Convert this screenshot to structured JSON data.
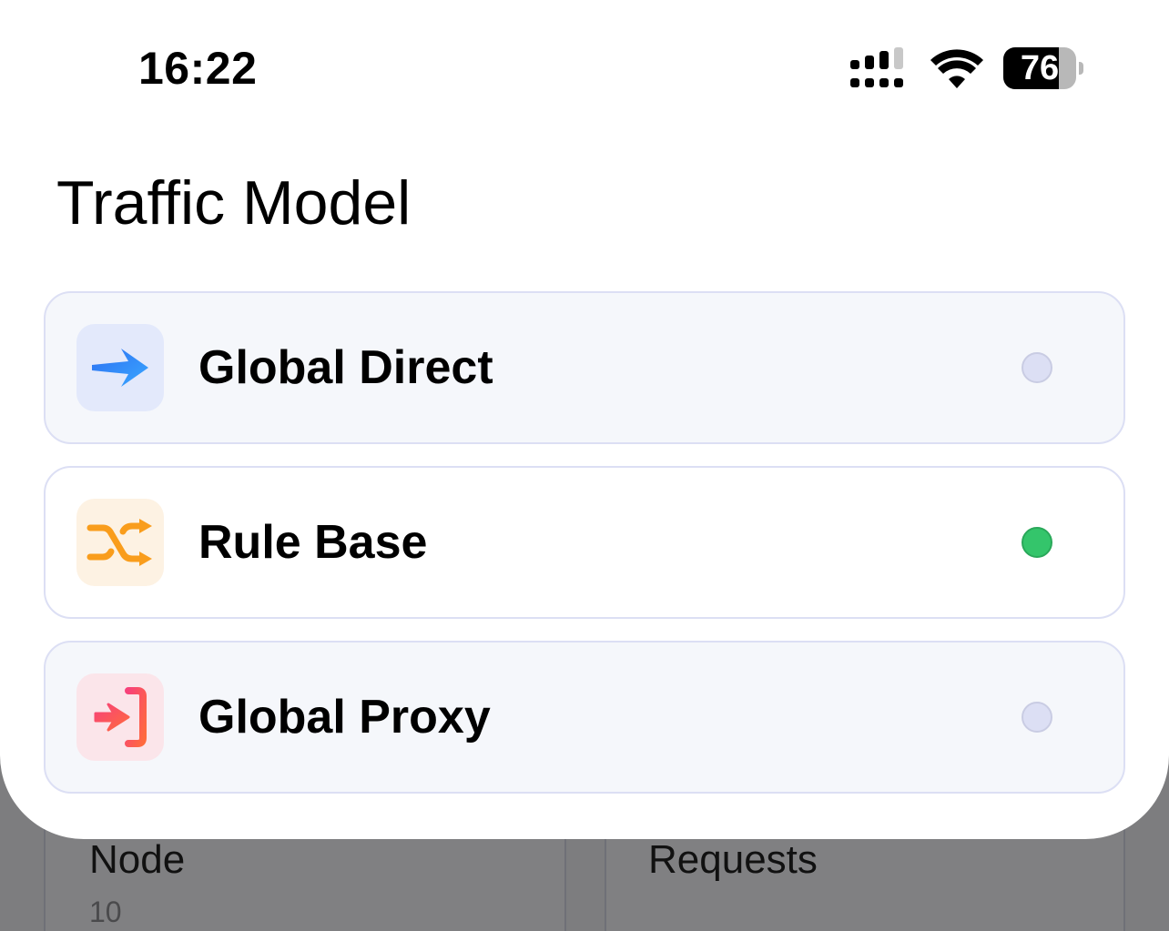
{
  "status_bar": {
    "time": "16:22",
    "battery_percent": 76,
    "battery_label": "76",
    "icons": [
      "cellular-signal-icon",
      "wifi-icon",
      "battery-icon"
    ]
  },
  "sheet": {
    "title": "Traffic Model",
    "options": [
      {
        "label": "Global Direct",
        "icon": "direct-arrow-icon",
        "icon_bg": "#e3e9fb",
        "selected": false
      },
      {
        "label": "Rule Base",
        "icon": "shuffle-icon",
        "icon_bg": "#fdf2e3",
        "selected": true
      },
      {
        "label": "Global Proxy",
        "icon": "proxy-login-icon",
        "icon_bg": "#fbe5ea",
        "selected": false
      }
    ],
    "colors": {
      "radio_on": "#34c56b",
      "radio_off": "#dcdff4",
      "card_border": "#dcdff4"
    }
  },
  "background": {
    "cards": [
      {
        "title": "Node",
        "value": "10"
      },
      {
        "title": "Requests",
        "value": ""
      }
    ]
  }
}
